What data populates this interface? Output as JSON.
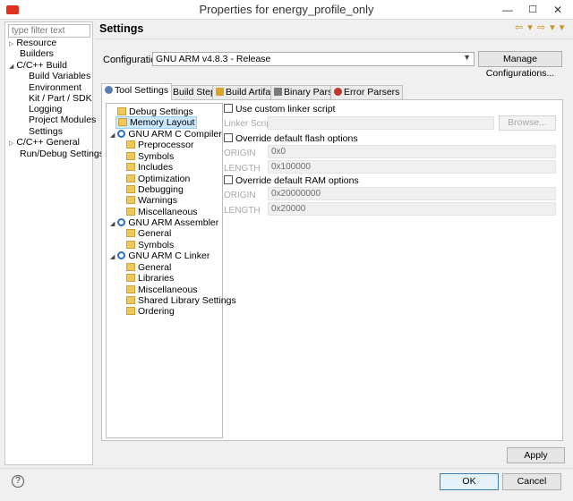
{
  "window": {
    "title": "Properties for energy_profile_only",
    "minimize": "—",
    "maximize": "☐",
    "close": "✕"
  },
  "sidebar": {
    "filter_placeholder": "type filter text",
    "items": [
      {
        "label": "Resource"
      },
      {
        "label": "Builders"
      },
      {
        "label": "C/C++ Build"
      },
      {
        "label": "Build Variables"
      },
      {
        "label": "Environment"
      },
      {
        "label": "Kit / Part / SDK"
      },
      {
        "label": "Logging"
      },
      {
        "label": "Project Modules"
      },
      {
        "label": "Settings"
      },
      {
        "label": "C/C++ General"
      },
      {
        "label": "Run/Debug Settings"
      }
    ]
  },
  "header": {
    "title": "Settings",
    "history_icons": "⇦ ▾ ⇨ ▾ ▾"
  },
  "config": {
    "label": "Configuration:",
    "value": "GNU ARM v4.8.3 - Release",
    "manage_button": "Manage Configurations..."
  },
  "tabs": [
    {
      "label": "Tool Settings",
      "color": "#5b7fb5"
    },
    {
      "label": "Build Steps",
      "color": "#8a8a8a"
    },
    {
      "label": "Build Artifact",
      "color": "#d9a526"
    },
    {
      "label": "Binary Parsers",
      "color": "#7a7a7a"
    },
    {
      "label": "Error Parsers",
      "color": "#c0392b"
    }
  ],
  "tool_tree": {
    "items": [
      {
        "label": "Debug Settings"
      },
      {
        "label": "Memory Layout"
      },
      {
        "label": "GNU ARM C Compiler"
      },
      {
        "label": "Preprocessor"
      },
      {
        "label": "Symbols"
      },
      {
        "label": "Includes"
      },
      {
        "label": "Optimization"
      },
      {
        "label": "Debugging"
      },
      {
        "label": "Warnings"
      },
      {
        "label": "Miscellaneous"
      },
      {
        "label": "GNU ARM Assembler"
      },
      {
        "label": "General"
      },
      {
        "label": "Symbols"
      },
      {
        "label": "GNU ARM C Linker"
      },
      {
        "label": "General"
      },
      {
        "label": "Libraries"
      },
      {
        "label": "Miscellaneous"
      },
      {
        "label": "Shared Library Settings"
      },
      {
        "label": "Ordering"
      }
    ]
  },
  "memory": {
    "custom_linker_label": "Use custom linker script",
    "linker_script_label": "Linker Script:",
    "linker_script_value": "",
    "browse_button": "Browse...",
    "flash_label": "Override default flash options",
    "flash_origin_label": "ORIGIN",
    "flash_origin_value": "0x0",
    "flash_length_label": "LENGTH",
    "flash_length_value": "0x100000",
    "ram_label": "Override default RAM options",
    "ram_origin_label": "ORIGIN",
    "ram_origin_value": "0x20000000",
    "ram_length_label": "LENGTH",
    "ram_length_value": "0x20000"
  },
  "footer": {
    "apply": "Apply",
    "ok": "OK",
    "cancel": "Cancel",
    "help_glyph": "?"
  }
}
